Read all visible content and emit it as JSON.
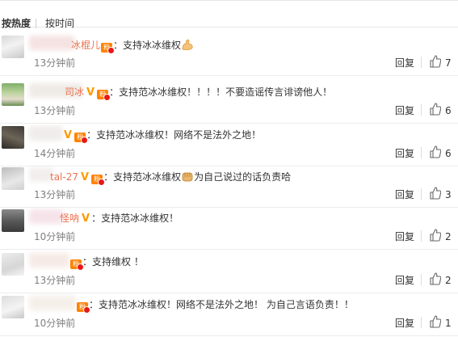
{
  "sort": {
    "hot_label": "按热度",
    "time_label": "按时间"
  },
  "reply_label": "回复",
  "comments": [
    {
      "name": "冰棍儿",
      "badges": [
        "fan"
      ],
      "text": "：支持冰冰维权",
      "emoji": "strong-arm-emoji",
      "time": "13分钟前",
      "likes": "7"
    },
    {
      "name": "司冰",
      "badges": [
        "v",
        "fan"
      ],
      "text": "：支持范冰冰维权！！！！不要造谣传言诽谤他人！",
      "time": "13分钟前",
      "likes": "6"
    },
    {
      "name": "",
      "badges": [
        "v",
        "fan"
      ],
      "text": "：支持范冰冰维权！网络不是法外之地！",
      "time": "14分钟前",
      "likes": "6"
    },
    {
      "name": "tal-27",
      "badges": [
        "v",
        "fan"
      ],
      "text": "：支持范冰冰维权",
      "emoji": "fist-emoji",
      "text2": "为自己说过的话负责哈",
      "time": "13分钟前",
      "likes": "3"
    },
    {
      "name": "怪呐",
      "badges": [
        "v"
      ],
      "text": "：支持范冰冰维权！",
      "time": "10分钟前",
      "likes": "2"
    },
    {
      "name": "",
      "badges": [
        "fan"
      ],
      "text": "：支持维权 ！",
      "time": "13分钟前",
      "likes": "2"
    },
    {
      "name": "",
      "badges": [
        "fan"
      ],
      "text": "：支持范冰冰维权！网络不是法外之地！ 为自己言语负责！！",
      "time": "10分钟前",
      "likes": "1"
    }
  ],
  "colors": {
    "username": "#eb7350",
    "vip": "#ff9a00",
    "fan_badge": "#ff8200",
    "time": "#808080"
  }
}
